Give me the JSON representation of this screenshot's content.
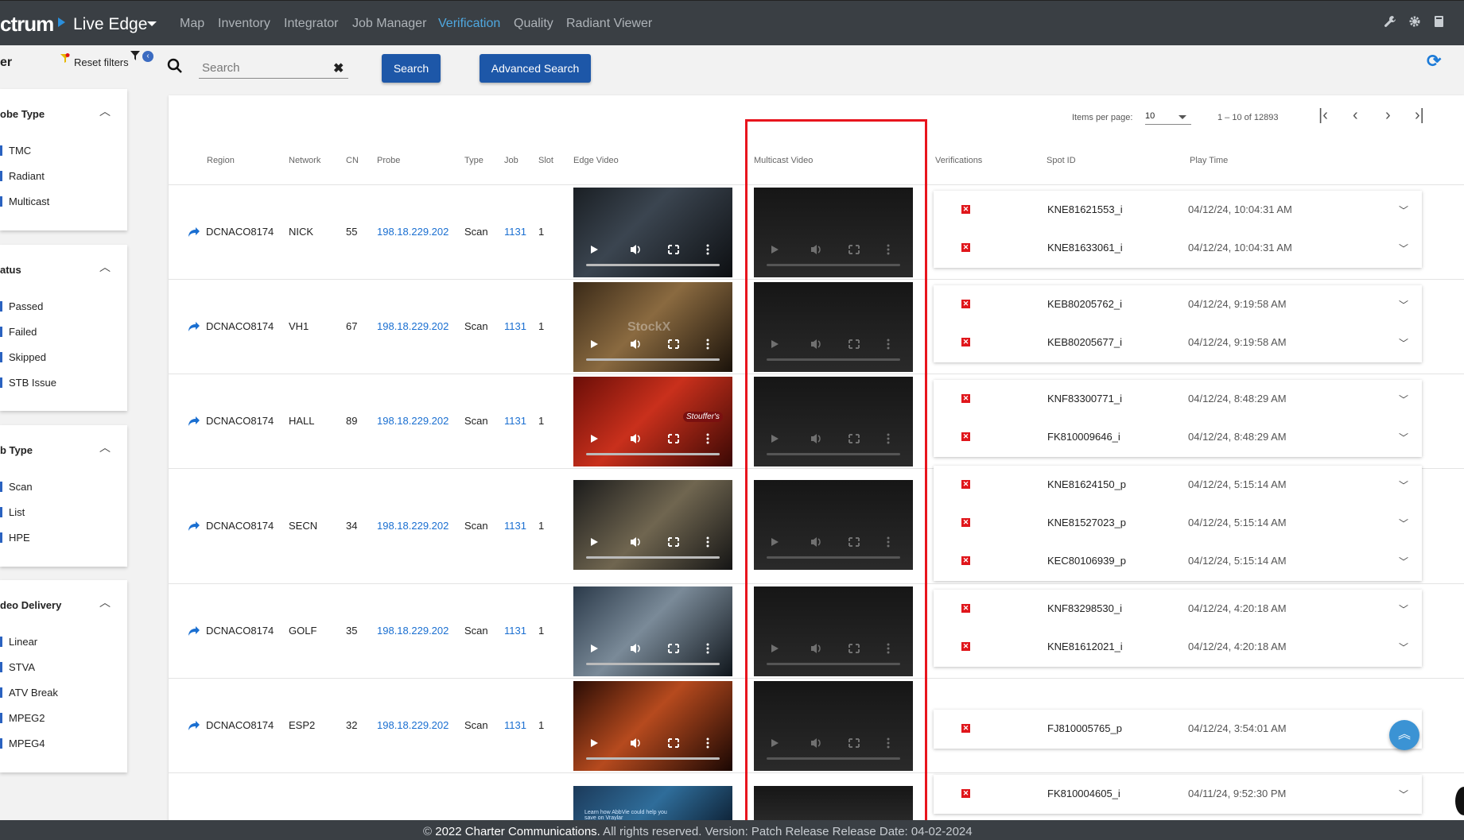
{
  "app": {
    "brand": "ctrum",
    "name": "Live Edge",
    "nav": [
      "Map",
      "Inventory",
      "Integrator",
      "Job Manager",
      "Verification",
      "Quality",
      "Radiant Viewer"
    ],
    "active_nav": "Verification",
    "top_icons": [
      "wrench-icon",
      "gear-icon",
      "book-icon"
    ]
  },
  "filters": {
    "title": "er",
    "reset_label": "Reset filters",
    "groups": [
      {
        "title": "obe Type",
        "options": [
          "TMC",
          "Radiant",
          "Multicast"
        ]
      },
      {
        "title": "atus",
        "options": [
          "Passed",
          "Failed",
          "Skipped",
          "STB Issue"
        ]
      },
      {
        "title": "b Type",
        "options": [
          "Scan",
          "List",
          "HPE"
        ]
      },
      {
        "title": "deo Delivery",
        "options": [
          "Linear",
          "STVA",
          "ATV Break",
          "MPEG2",
          "MPEG4"
        ]
      }
    ]
  },
  "search": {
    "placeholder": "Search",
    "value": "",
    "clear_label": "✖",
    "search_button": "Search",
    "advanced_button": "Advanced Search"
  },
  "pagination": {
    "items_per_page_label": "Items per page:",
    "items_per_page": "10",
    "range": "1 – 10 of 12893"
  },
  "table": {
    "headers": {
      "region": "Region",
      "network": "Network",
      "cn": "CN",
      "probe": "Probe",
      "type": "Type",
      "job": "Job",
      "slot": "Slot",
      "edge_video": "Edge Video",
      "multicast_video": "Multicast Video",
      "verifications": "Verifications",
      "spot_id": "Spot ID",
      "play_time": "Play Time"
    },
    "rows": [
      {
        "region": "DCNACO8174",
        "network": "NICK",
        "cn": "55",
        "probe": "198.18.229.202",
        "type": "Scan",
        "job": "1131",
        "slot": "1",
        "verifications": [
          {
            "spot": "KNE81621553_i",
            "time": "04/12/24, 10:04:31 AM"
          },
          {
            "spot": "KNE81633061_i",
            "time": "04/12/24, 10:04:31 AM"
          }
        ]
      },
      {
        "region": "DCNACO8174",
        "network": "VH1",
        "cn": "67",
        "probe": "198.18.229.202",
        "type": "Scan",
        "job": "1131",
        "slot": "1",
        "verifications": [
          {
            "spot": "KEB80205762_i",
            "time": "04/12/24, 9:19:58 AM"
          },
          {
            "spot": "KEB80205677_i",
            "time": "04/12/24, 9:19:58 AM"
          }
        ]
      },
      {
        "region": "DCNACO8174",
        "network": "HALL",
        "cn": "89",
        "probe": "198.18.229.202",
        "type": "Scan",
        "job": "1131",
        "slot": "1",
        "verifications": [
          {
            "spot": "KNF83300771_i",
            "time": "04/12/24, 8:48:29 AM"
          },
          {
            "spot": "FK810009646_i",
            "time": "04/12/24, 8:48:29 AM"
          }
        ]
      },
      {
        "region": "DCNACO8174",
        "network": "SECN",
        "cn": "34",
        "probe": "198.18.229.202",
        "type": "Scan",
        "job": "1131",
        "slot": "1",
        "verifications": [
          {
            "spot": "KNE81624150_p",
            "time": "04/12/24, 5:15:14 AM"
          },
          {
            "spot": "KNE81527023_p",
            "time": "04/12/24, 5:15:14 AM"
          },
          {
            "spot": "KEC80106939_p",
            "time": "04/12/24, 5:15:14 AM"
          }
        ]
      },
      {
        "region": "DCNACO8174",
        "network": "GOLF",
        "cn": "35",
        "probe": "198.18.229.202",
        "type": "Scan",
        "job": "1131",
        "slot": "1",
        "verifications": [
          {
            "spot": "KNF83298530_i",
            "time": "04/12/24, 4:20:18 AM"
          },
          {
            "spot": "KNE81612021_i",
            "time": "04/12/24, 4:20:18 AM"
          }
        ]
      },
      {
        "region": "DCNACO8174",
        "network": "ESP2",
        "cn": "32",
        "probe": "198.18.229.202",
        "type": "Scan",
        "job": "1131",
        "slot": "1",
        "verifications": [
          {
            "spot": "FJ810005765_p",
            "time": "04/12/24, 3:54:01 AM"
          }
        ]
      },
      {
        "region": "",
        "network": "",
        "cn": "",
        "probe": "",
        "type": "",
        "job": "",
        "slot": "",
        "verifications": [
          {
            "spot": "FK810004605_i",
            "time": "04/11/24, 9:52:30 PM"
          }
        ]
      }
    ],
    "thumbnail_caption": "Learn how AbbVie could help you save on Vraylar",
    "watermark": "StockX",
    "brand_mark": "Stouffer's"
  },
  "footer": {
    "text": "2022 Charter Communications.",
    "rest": " All rights reserved. Version: Patch Release Release Date: 04-02-2024"
  },
  "colors": {
    "topbar": "#3a3f44",
    "accent": "#1d57a8",
    "link": "#1a6fd1",
    "fail": "#e0161b",
    "highlight": "#e8141d"
  }
}
